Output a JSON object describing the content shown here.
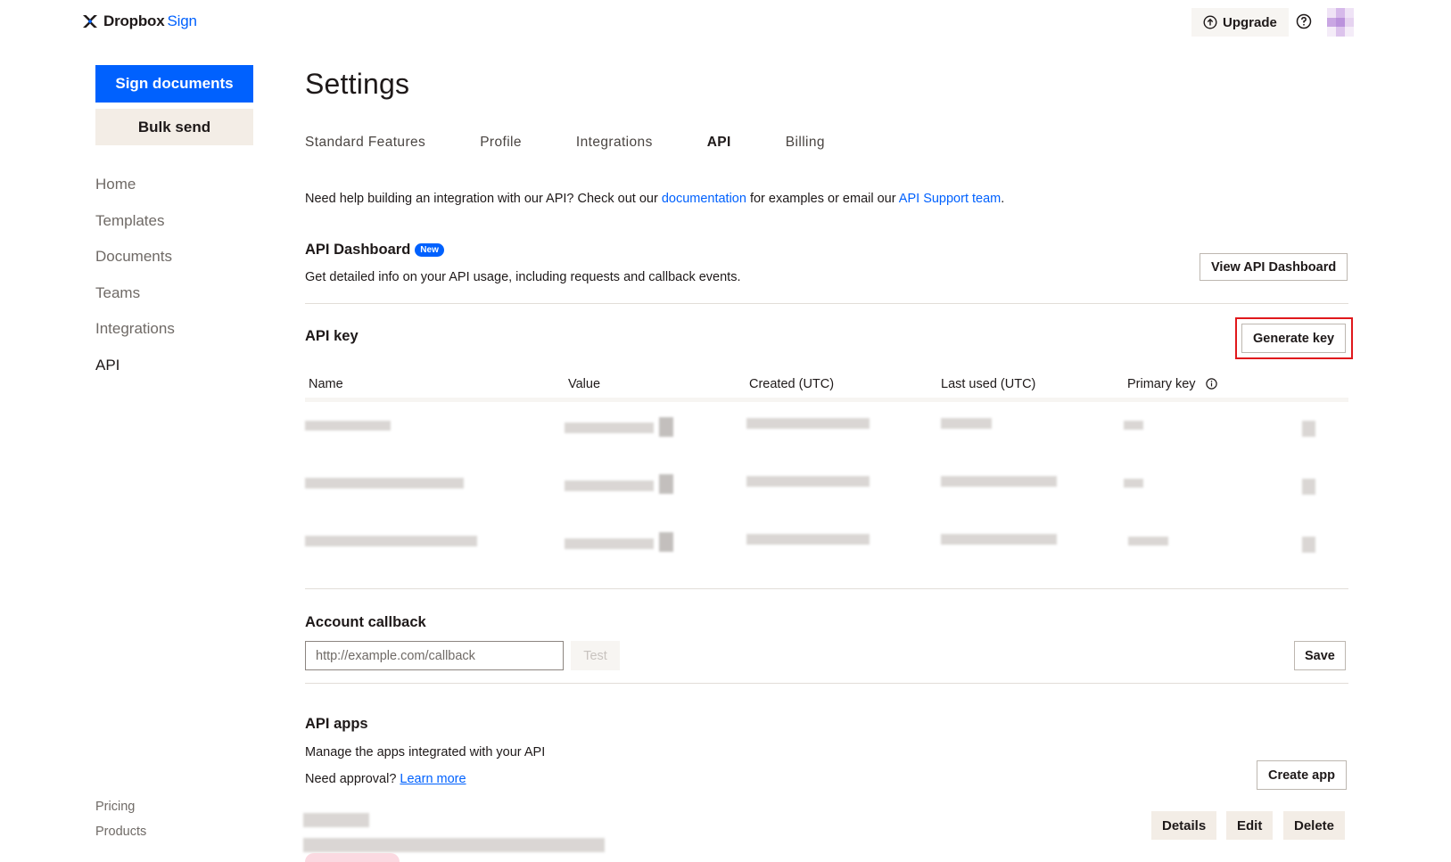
{
  "brand": {
    "name": "Dropbox",
    "product": "Sign"
  },
  "header": {
    "upgrade_label": "Upgrade"
  },
  "sidebar": {
    "primary_button": "Sign documents",
    "secondary_button": "Bulk send",
    "nav": [
      {
        "label": "Home"
      },
      {
        "label": "Templates"
      },
      {
        "label": "Documents"
      },
      {
        "label": "Teams"
      },
      {
        "label": "Integrations"
      },
      {
        "label": "API"
      }
    ],
    "footer": [
      {
        "label": "Pricing"
      },
      {
        "label": "Products"
      }
    ]
  },
  "main": {
    "title": "Settings",
    "tabs": [
      {
        "label": "Standard Features"
      },
      {
        "label": "Profile"
      },
      {
        "label": "Integrations"
      },
      {
        "label": "API"
      },
      {
        "label": "Billing"
      }
    ],
    "help": {
      "before": "Need help building an integration with our API? Check out our ",
      "doc_link": "documentation",
      "middle": " for examples or email our ",
      "support_link": "API Support team",
      "after": "."
    },
    "dashboard": {
      "title": "API Dashboard",
      "badge": "New",
      "desc": "Get detailed info on your API usage, including requests and callback events.",
      "button": "View API Dashboard"
    },
    "api_key": {
      "title": "API key",
      "generate_button": "Generate key",
      "columns": [
        "Name",
        "Value",
        "Created (UTC)",
        "Last used (UTC)",
        "Primary key"
      ]
    },
    "callback": {
      "title": "Account callback",
      "placeholder": "http://example.com/callback",
      "test_button": "Test",
      "save_button": "Save"
    },
    "apps": {
      "title": "API apps",
      "desc": "Manage the apps integrated with your API",
      "approval_text": "Need approval?",
      "learn_more": "Learn more",
      "create_button": "Create app",
      "details_button": "Details",
      "edit_button": "Edit",
      "delete_button": "Delete"
    }
  },
  "colors": {
    "accent": "#0061fe",
    "beige": "#f3ede6",
    "highlight": "#e0181c"
  }
}
